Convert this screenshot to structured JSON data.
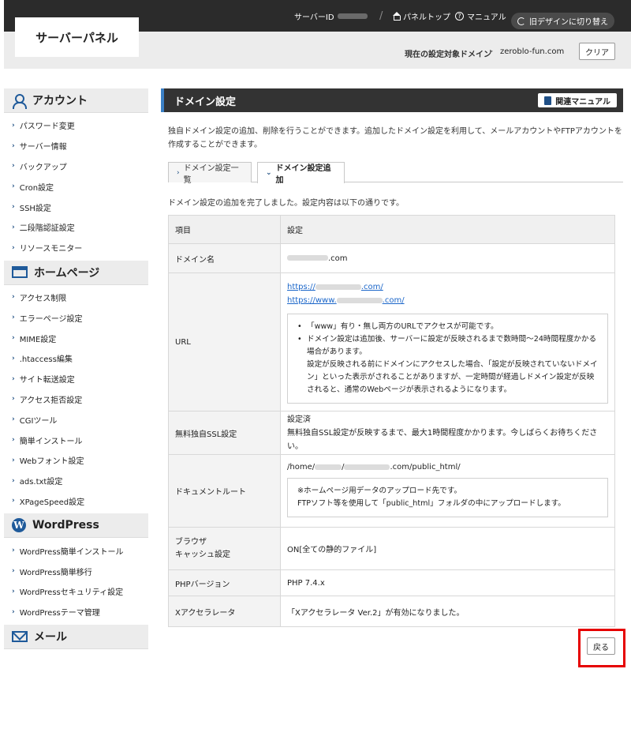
{
  "header": {
    "logo": "サーバーパネル",
    "server_id_label": "サーバーID",
    "slash": "/",
    "panel_top": "パネルトップ",
    "manual": "マニュアル",
    "old_design": "旧デザインに切り替え",
    "current_domain_label": "現在の設定対象ドメイン",
    "current_domain_arrow": "▸",
    "current_domain": "zeroblo-fun.com",
    "clear": "クリア"
  },
  "sidebar": {
    "sections": [
      {
        "title": "アカウント",
        "icon": "user-icon",
        "items": [
          "パスワード変更",
          "サーバー情報",
          "バックアップ",
          "Cron設定",
          "SSH設定",
          "二段階認証設定",
          "リソースモニター"
        ]
      },
      {
        "title": "ホームページ",
        "icon": "window-icon",
        "items": [
          "アクセス制限",
          "エラーページ設定",
          "MIME設定",
          ".htaccess編集",
          "サイト転送設定",
          "アクセス拒否設定",
          "CGIツール",
          "簡単インストール",
          "Webフォント設定",
          "ads.txt設定",
          "XPageSpeed設定"
        ]
      },
      {
        "title": "WordPress",
        "icon": "wordpress-icon",
        "items": [
          "WordPress簡単インストール",
          "WordPress簡単移行",
          "WordPressセキュリティ設定",
          "WordPressテーマ管理"
        ]
      },
      {
        "title": "メール",
        "icon": "mail-icon",
        "items": []
      }
    ]
  },
  "main": {
    "title": "ドメイン設定",
    "related_manual": "関連マニュアル",
    "intro": "独自ドメイン設定の追加、削除を行うことができます。追加したドメイン設定を利用して、メールアカウントやFTPアカウントを作成することができます。",
    "tabs": [
      "ドメイン設定一覧",
      "ドメイン設定追加"
    ],
    "done_message": "ドメイン設定の追加を完了しました。設定内容は以下の通りです。",
    "table": {
      "col_item": "項目",
      "col_setting": "設定",
      "domain_label": "ドメイン名",
      "domain_suffix": ".com",
      "url_label": "URL",
      "url1_prefix": "https://",
      "url1_suffix": ".com/",
      "url2_prefix": "https://www.",
      "url2_suffix": ".com/",
      "url_note1": "「www」有り・無し両方のURLでアクセスが可能です。",
      "url_note2": "ドメイン設定は追加後、サーバーに設定が反映されるまで数時間〜24時間程度かかる場合があります。",
      "url_note3": "設定が反映される前にドメインにアクセスした場合、「設定が反映されていないドメイン」といった表示がされることがありますが、一定時間が経過しドメイン設定が反映されると、通常のWebページが表示されるようになります。",
      "ssl_label": "無料独自SSL設定",
      "ssl_status": "設定済",
      "ssl_note": "無料独自SSL設定が反映するまで、最大1時間程度かかります。今しばらくお待ちください。",
      "docroot_label": "ドキュメントルート",
      "docroot_prefix": "/home/",
      "docroot_mid": "/",
      "docroot_suffix": ".com/public_html/",
      "docroot_note1": "※ホームページ用データのアップロード先です。",
      "docroot_note2": "FTPソフト等を使用して「public_html」フォルダの中にアップロードします。",
      "cache_label_1": "ブラウザ",
      "cache_label_2": "キャッシュ設定",
      "cache_value": "ON[全ての静的ファイル]",
      "php_label": "PHPバージョン",
      "php_value": "PHP 7.4.x",
      "xacc_label": "Xアクセラレータ",
      "xacc_value": "「Xアクセラレータ Ver.2」が有効になりました。"
    },
    "back_button": "戻る"
  }
}
